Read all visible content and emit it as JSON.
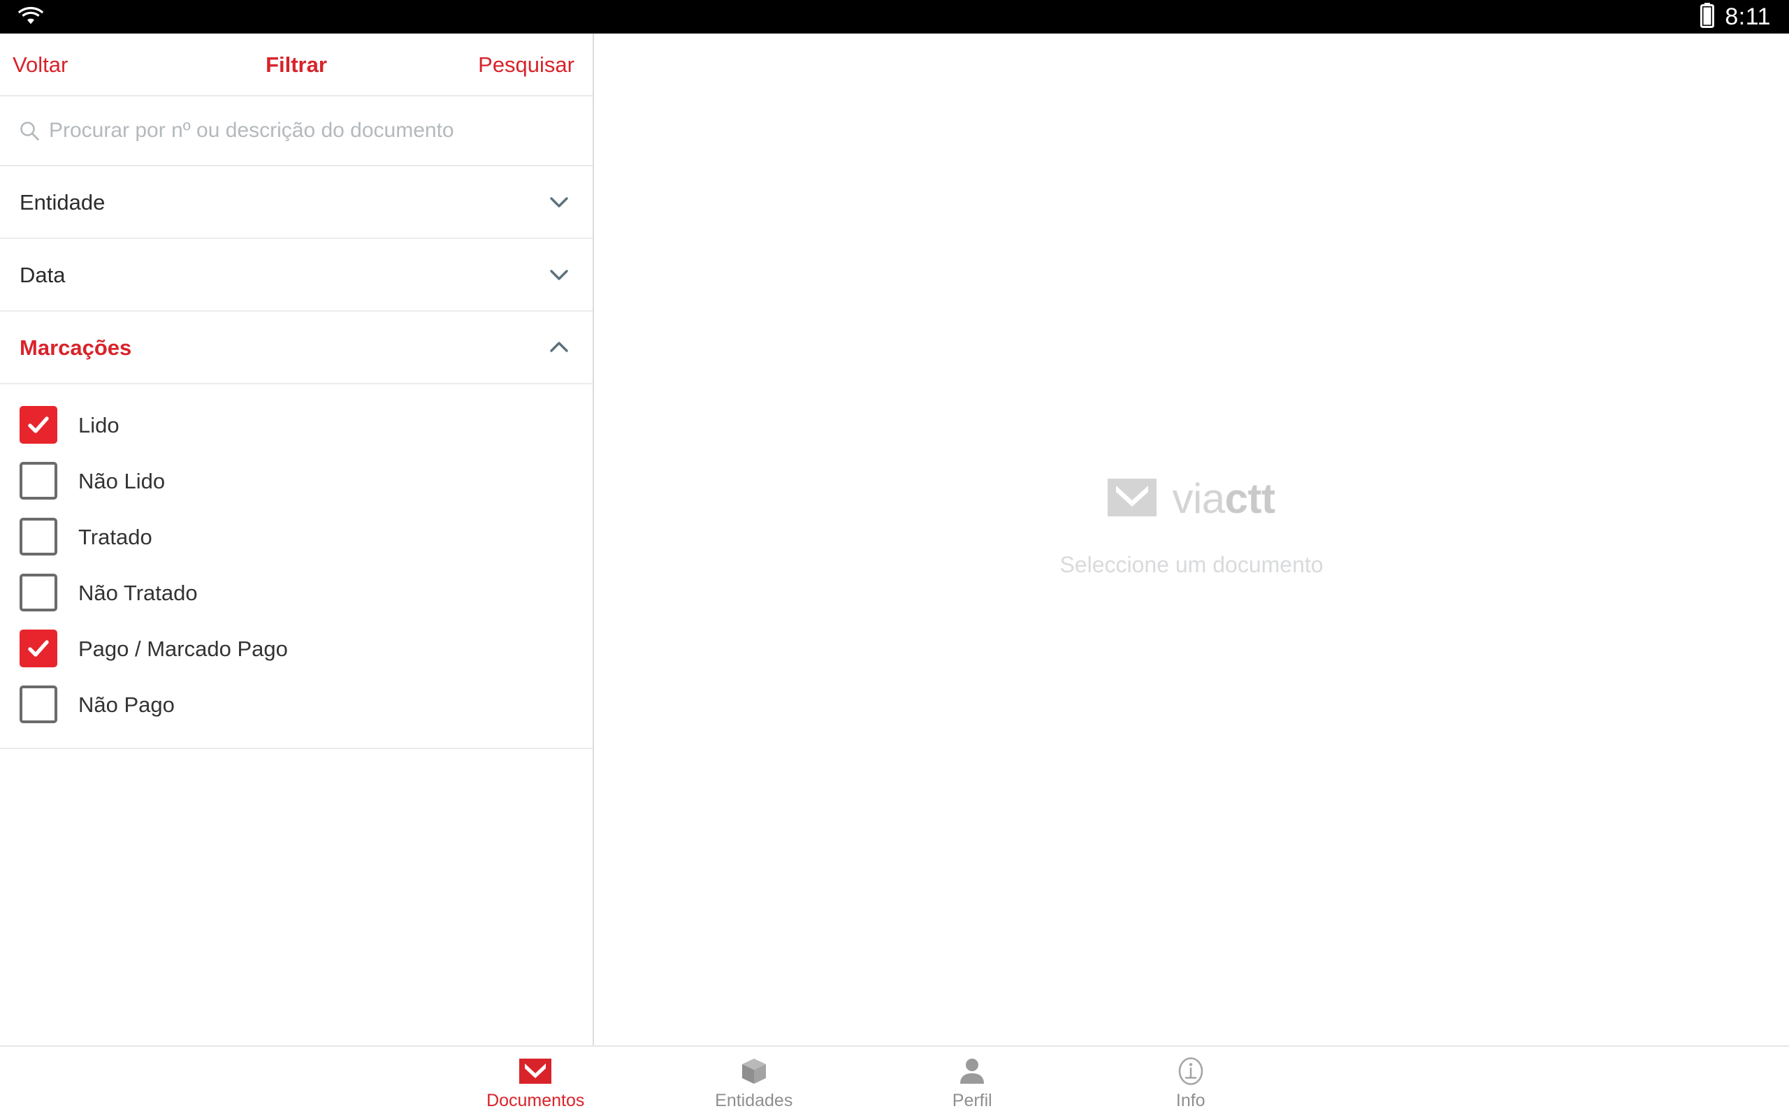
{
  "status_bar": {
    "wifi_icon": "wifi-icon",
    "battery_icon": "battery-full-icon",
    "time": "8:11"
  },
  "colors": {
    "brand_red": "#d8232a",
    "checkbox_red": "#e8252c",
    "chevron": "#5b717c",
    "muted_text": "#8f8f8f",
    "placeholder": "#b4b9bd"
  },
  "top_bar": {
    "back_label": "Voltar",
    "title": "Filtrar",
    "search_label": "Pesquisar"
  },
  "search": {
    "icon": "search-icon",
    "value": "",
    "placeholder": "Procurar por nº ou descrição do documento"
  },
  "filters": {
    "sections": [
      {
        "label": "Entidade",
        "expanded": false,
        "chevron": "chevron-down-icon"
      },
      {
        "label": "Data",
        "expanded": false,
        "chevron": "chevron-down-icon"
      },
      {
        "label": "Marcações",
        "expanded": true,
        "chevron": "chevron-up-icon"
      }
    ],
    "marcacoes_options": [
      {
        "label": "Lido",
        "checked": true
      },
      {
        "label": "Não Lido",
        "checked": false
      },
      {
        "label": "Tratado",
        "checked": false
      },
      {
        "label": "Não Tratado",
        "checked": false
      },
      {
        "label": "Pago / Marcado Pago",
        "checked": true
      },
      {
        "label": "Não Pago",
        "checked": false
      }
    ]
  },
  "detail_pane": {
    "logo_icon": "viactt-envelope-logo",
    "brand_light": "via",
    "brand_bold": "ctt",
    "empty_message": "Seleccione um documento"
  },
  "bottom_nav": {
    "items": [
      {
        "label": "Documentos",
        "icon": "envelope-icon",
        "active": true
      },
      {
        "label": "Entidades",
        "icon": "box-icon",
        "active": false
      },
      {
        "label": "Perfil",
        "icon": "person-icon",
        "active": false
      },
      {
        "label": "Info",
        "icon": "info-circle-icon",
        "active": false
      }
    ]
  }
}
